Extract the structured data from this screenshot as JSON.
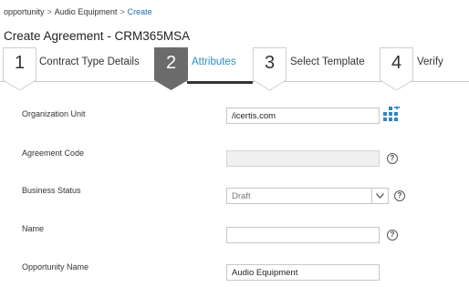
{
  "breadcrumb": {
    "items": [
      "opportunity",
      "Audio Equipment",
      "Create"
    ],
    "separator": ">"
  },
  "page": {
    "title": "Create Agreement - CRM365MSA"
  },
  "wizard": {
    "steps": [
      {
        "number": "1",
        "label": "Contract Type Details",
        "active": false
      },
      {
        "number": "2",
        "label": "Attributes",
        "active": true
      },
      {
        "number": "3",
        "label": "Select Template",
        "active": false
      },
      {
        "number": "4",
        "label": "Verify",
        "active": false
      }
    ],
    "colors": {
      "active_badge": "#6b6b6b",
      "active_label": "#2b8fc7",
      "badge_border": "#d0d0d0"
    }
  },
  "form": {
    "organization_unit": {
      "label": "Organization Unit",
      "value": "/icertis.com"
    },
    "agreement_code": {
      "label": "Agreement Code",
      "value": ""
    },
    "business_status": {
      "label": "Business Status",
      "value": "Draft"
    },
    "name": {
      "label": "Name",
      "value": ""
    },
    "opportunity_name": {
      "label": "Opportunity Name",
      "value": "Audio Equipment"
    }
  },
  "icons": {
    "help": "?",
    "hierarchy": "org-hierarchy-icon",
    "dropdown": "chevron-down-icon"
  },
  "colors": {
    "accent": "#2b8fc7",
    "hierarchy_icon": "#2e86c1"
  }
}
